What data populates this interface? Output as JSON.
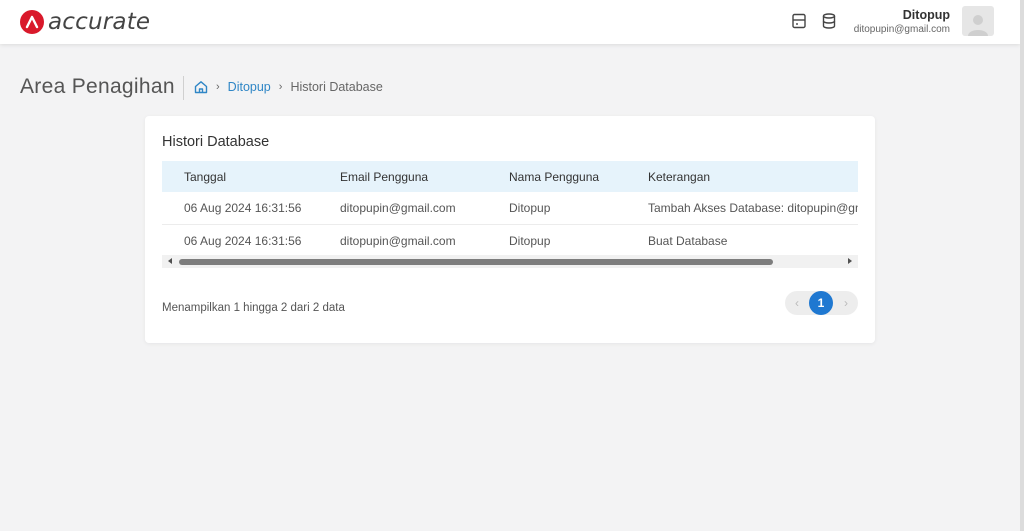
{
  "header": {
    "brand": "accurate",
    "user_name": "Ditopup",
    "user_email": "ditopupin@gmail.com",
    "icons": [
      "archive-box-icon",
      "database-icon"
    ]
  },
  "page": {
    "title": "Area Penagihan",
    "breadcrumb": {
      "link": "Ditopup",
      "current": "Histori Database"
    }
  },
  "card": {
    "title": "Histori Database",
    "columns": [
      "Tanggal",
      "Email Pengguna",
      "Nama Pengguna",
      "Keterangan"
    ],
    "rows": [
      [
        "06 Aug 2024 16:31:56",
        "ditopupin@gmail.com",
        "Ditopup",
        "Tambah Akses Database: ditopupin@gmail.com"
      ],
      [
        "06 Aug 2024 16:31:56",
        "ditopupin@gmail.com",
        "Ditopup",
        "Buat Database"
      ]
    ],
    "footer": "Menampilkan 1 hingga 2 dari 2 data",
    "pagination": {
      "prev": "‹",
      "current": "1",
      "next": "›"
    }
  },
  "colors": {
    "brand": "#d9192b",
    "accent": "#1f78d1",
    "link": "#2f86c6",
    "table_header": "#e6f3fb"
  }
}
